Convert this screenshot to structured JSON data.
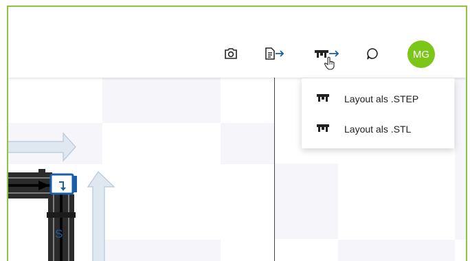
{
  "toolbar": {
    "buttons": [
      {
        "name": "screenshot",
        "icon": "camera-icon"
      },
      {
        "name": "export",
        "icon": "document-export-icon"
      },
      {
        "name": "layout-export",
        "icon": "layout-export-icon"
      },
      {
        "name": "comments",
        "icon": "chat-bubble-icon"
      }
    ],
    "avatar": {
      "initials": "MG",
      "color": "#7cc61a"
    }
  },
  "menu": {
    "items": [
      {
        "label": "Layout als .STEP",
        "icon": "layout-icon"
      },
      {
        "label": "Layout als .STL",
        "icon": "layout-icon"
      }
    ]
  },
  "canvas": {
    "marker_label": "S",
    "colors": {
      "frame": "#8cc63f",
      "accent": "#1a5ea8",
      "arrow_fill": "#dfe7f1",
      "arrow_stroke": "#b8c7d9",
      "grid": "#f5f5fa"
    }
  }
}
